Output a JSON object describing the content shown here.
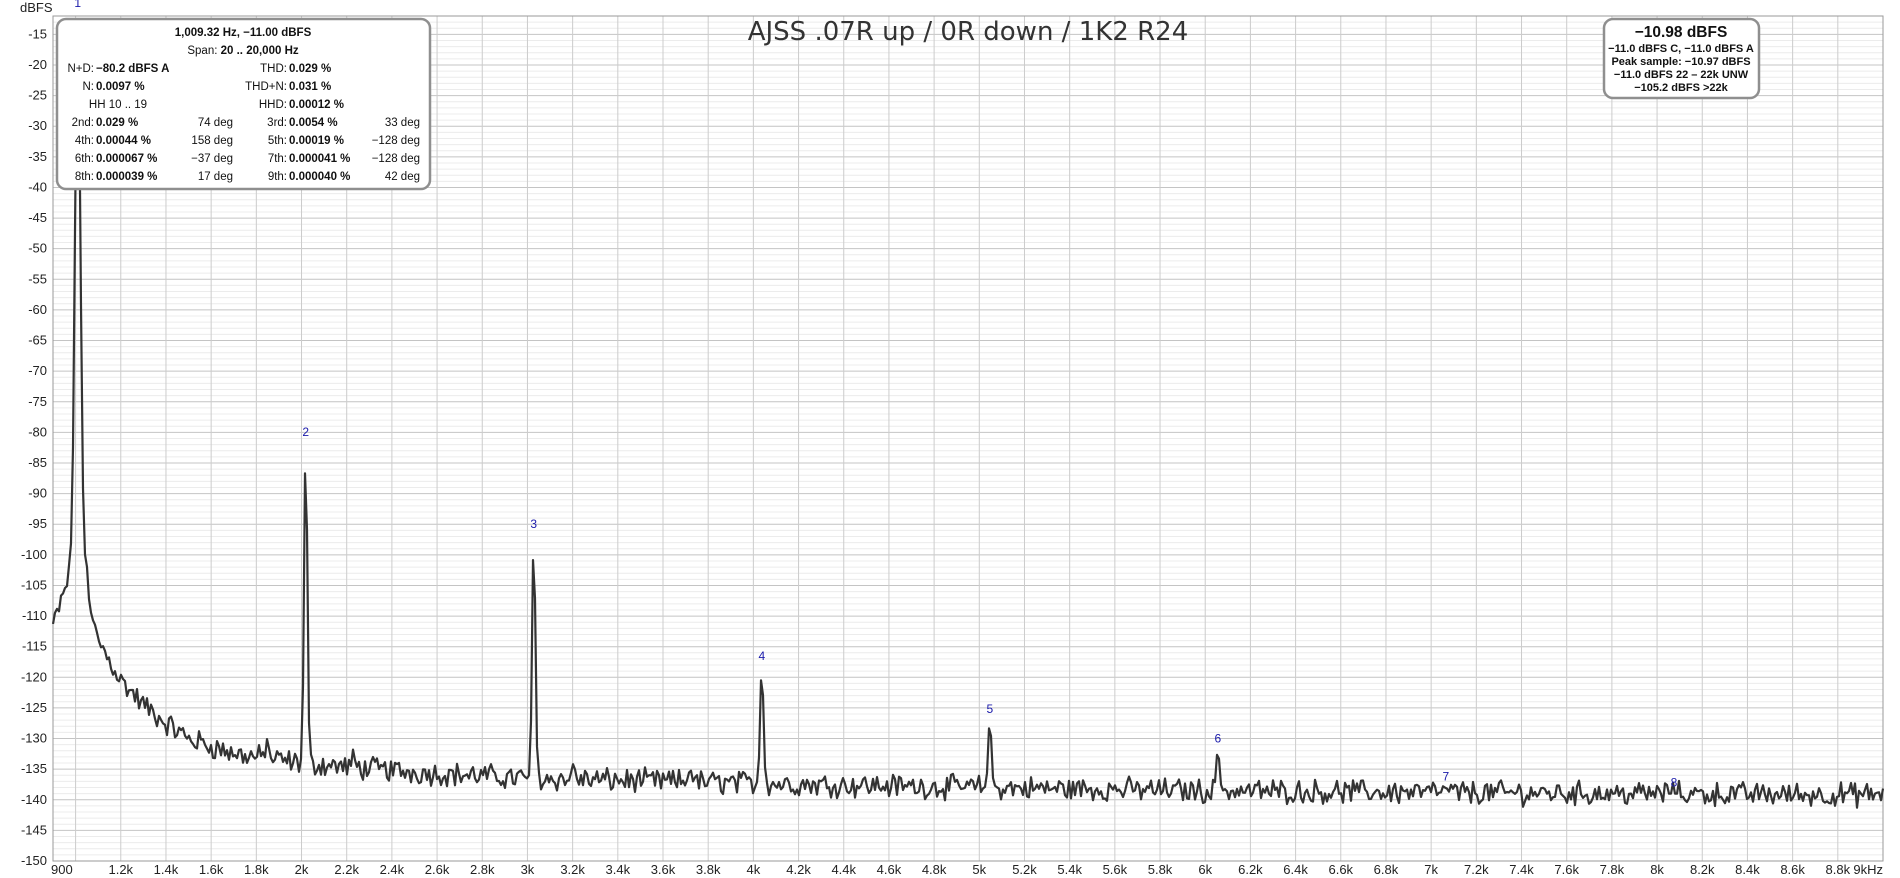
{
  "chart_data": {
    "type": "line",
    "title": "AJSS .07R up / 0R down / 1K2 R24",
    "ylabel": "dBFS",
    "xlabel": "",
    "xlim": [
      900,
      9000
    ],
    "ylim": [
      -150,
      -12
    ],
    "x_tick_labels": [
      "900",
      "1.2k",
      "1.4k",
      "1.6k",
      "1.8k",
      "2k",
      "2.2k",
      "2.4k",
      "2.6k",
      "2.8k",
      "3k",
      "3.2k",
      "3.4k",
      "3.6k",
      "3.8k",
      "4k",
      "4.2k",
      "4.4k",
      "4.6k",
      "4.8k",
      "5k",
      "5.2k",
      "5.4k",
      "5.6k",
      "5.8k",
      "6k",
      "6.2k",
      "6.4k",
      "6.6k",
      "6.8k",
      "7k",
      "7.2k",
      "7.4k",
      "7.6k",
      "7.8k",
      "8k",
      "8.2k",
      "8.4k",
      "8.6k",
      "8.8k",
      "9kHz"
    ],
    "y_tick_labels": [
      "-15",
      "-20",
      "-25",
      "-30",
      "-35",
      "-40",
      "-45",
      "-50",
      "-55",
      "-60",
      "-65",
      "-70",
      "-75",
      "-80",
      "-85",
      "-90",
      "-95",
      "-100",
      "-105",
      "-110",
      "-115",
      "-120",
      "-125",
      "-130",
      "-135",
      "-140",
      "-145",
      "-150"
    ],
    "series_color": "#333333",
    "fundamental": {
      "freq": 1009.32,
      "level": -11.0,
      "label": "1"
    },
    "harmonics": [
      {
        "label": "2",
        "freq": 2018.6,
        "level": -81.7
      },
      {
        "label": "3",
        "freq": 3027.9,
        "level": -96.8
      },
      {
        "label": "4",
        "freq": 4037.3,
        "level": -118.3
      },
      {
        "label": "5",
        "freq": 5046.6,
        "level": -127.0
      },
      {
        "label": "6",
        "freq": 6055.9,
        "level": -131.8
      },
      {
        "label": "7",
        "freq": 7065.2,
        "level": -138.0
      },
      {
        "label": "8",
        "freq": 8074.6,
        "level": -139.0
      }
    ],
    "spurs": [
      {
        "freq": 1850,
        "level": -129.5
      },
      {
        "freq": 2230,
        "level": -131.5
      },
      {
        "freq": 3205,
        "level": -133.5
      },
      {
        "freq": 3720,
        "level": -134.5
      }
    ],
    "noise_floor": [
      {
        "freq": 900,
        "level": -111.5
      },
      {
        "freq": 1000,
        "level": -101.0
      },
      {
        "freq": 1100,
        "level": -114.0
      },
      {
        "freq": 1200,
        "level": -120.5
      },
      {
        "freq": 1300,
        "level": -124.5
      },
      {
        "freq": 1400,
        "level": -127.5
      },
      {
        "freq": 1500,
        "level": -130.0
      },
      {
        "freq": 1700,
        "level": -132.5
      },
      {
        "freq": 2000,
        "level": -134.0
      },
      {
        "freq": 2500,
        "level": -135.5
      },
      {
        "freq": 3000,
        "level": -136.5
      },
      {
        "freq": 4000,
        "level": -137.3
      },
      {
        "freq": 5000,
        "level": -138.0
      },
      {
        "freq": 6000,
        "level": -138.5
      },
      {
        "freq": 7000,
        "level": -138.8
      },
      {
        "freq": 8000,
        "level": -139.0
      },
      {
        "freq": 9000,
        "level": -139.2
      }
    ]
  },
  "info_panel": {
    "peak_line": "1,009.32 Hz, −11.00 dBFS",
    "span_label": "Span:",
    "span_value": "20 .. 20,000 Hz",
    "nd_label": "N+D:",
    "nd_value": "−80.2 dBFS A",
    "thd_label": "THD:",
    "thd_value": "0.029 %",
    "n_label": "N:",
    "n_value": "0.0097 %",
    "thdn_label": "THD+N:",
    "thdn_value": "0.031 %",
    "hh_label": "HH 10 .. 19",
    "hhd_label": "HHD:",
    "hhd_value": "0.00012 %",
    "harmonic_rows": [
      {
        "l_label": "2nd:",
        "l_value": "0.029 %",
        "l_phase": "74 deg",
        "r_label": "3rd:",
        "r_value": "0.0054 %",
        "r_phase": "33 deg"
      },
      {
        "l_label": "4th:",
        "l_value": "0.00044 %",
        "l_phase": "158 deg",
        "r_label": "5th:",
        "r_value": "0.00019 %",
        "r_phase": "−128 deg"
      },
      {
        "l_label": "6th:",
        "l_value": "0.000067 %",
        "l_phase": "−37 deg",
        "r_label": "7th:",
        "r_value": "0.000041 %",
        "r_phase": "−128 deg"
      },
      {
        "l_label": "8th:",
        "l_value": "0.000039 %",
        "l_phase": "17 deg",
        "r_label": "9th:",
        "r_value": "0.000040 %",
        "r_phase": "42 deg"
      }
    ]
  },
  "level_panel": {
    "main": "−10.98 dBFS",
    "lines": [
      "−11.0 dBFS C, −11.0 dBFS A",
      "Peak sample: −10.97 dBFS",
      "−11.0 dBFS 22 – 22k UNW",
      "−105.2 dBFS >22k"
    ]
  }
}
